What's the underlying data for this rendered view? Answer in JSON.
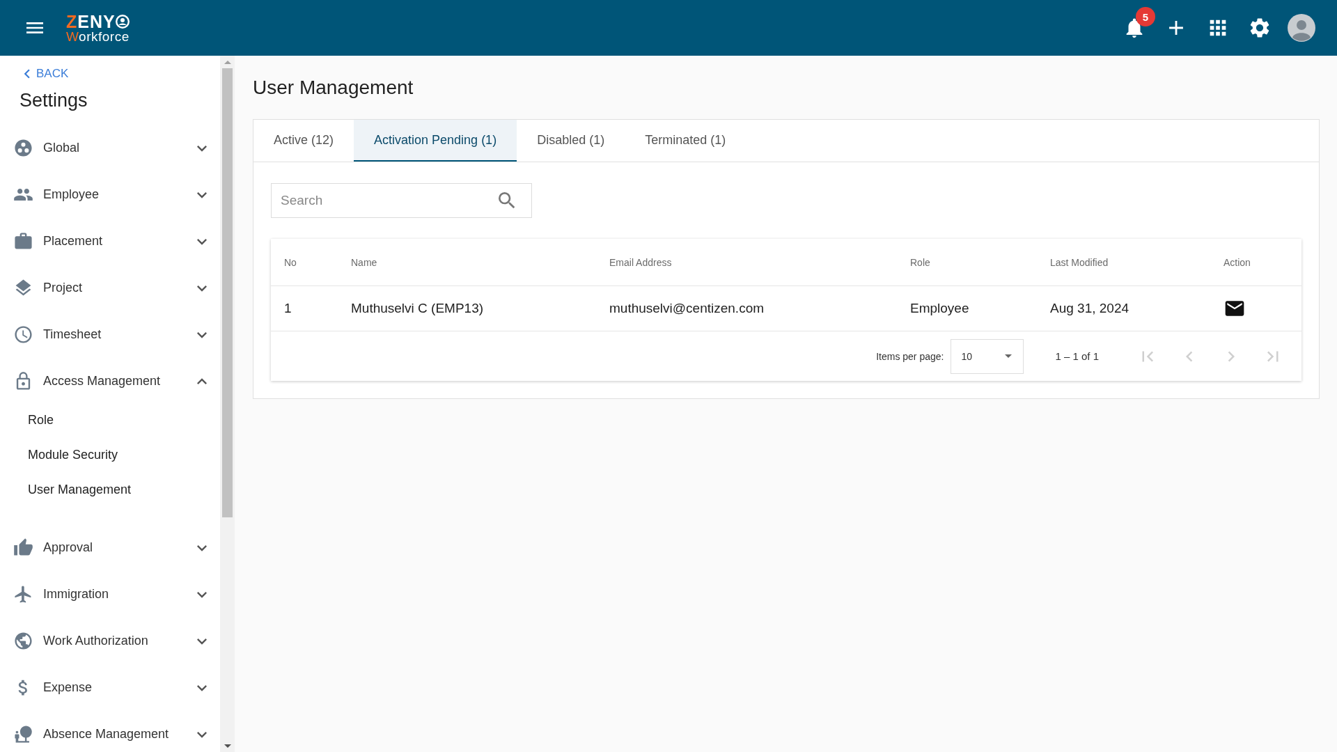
{
  "topbar": {
    "logo": {
      "line_1": {
        "accent": "Z",
        "rest": "ENY"
      },
      "line_2": {
        "accent": "W",
        "rest": "orkforce"
      }
    },
    "notification_count": "5"
  },
  "sidebar": {
    "back_label": "BACK",
    "title": "Settings",
    "items": [
      {
        "label": "Global",
        "expanded": false
      },
      {
        "label": "Employee",
        "expanded": false
      },
      {
        "label": "Placement",
        "expanded": false
      },
      {
        "label": "Project",
        "expanded": false
      },
      {
        "label": "Timesheet",
        "expanded": false
      },
      {
        "label": "Access Management",
        "expanded": true,
        "children": [
          {
            "label": "Role"
          },
          {
            "label": "Module Security"
          },
          {
            "label": "User Management"
          }
        ]
      },
      {
        "label": "Approval",
        "expanded": false
      },
      {
        "label": "Immigration",
        "expanded": false
      },
      {
        "label": "Work Authorization",
        "expanded": false
      },
      {
        "label": "Expense",
        "expanded": false
      },
      {
        "label": "Absence Management",
        "expanded": false
      }
    ]
  },
  "page": {
    "title": "User Management"
  },
  "tabs": [
    {
      "label": "Active (12)",
      "selected": false
    },
    {
      "label": "Activation Pending (1)",
      "selected": true
    },
    {
      "label": "Disabled (1)",
      "selected": false
    },
    {
      "label": "Terminated (1)",
      "selected": false
    }
  ],
  "search": {
    "placeholder": "Search"
  },
  "table": {
    "columns": [
      "No",
      "Name",
      "Email Address",
      "Role",
      "Last Modified",
      "Action"
    ],
    "rows": [
      {
        "cells": [
          "1",
          "Muthuselvi C (EMP13)",
          "muthuselvi@centizen.com",
          "Employee",
          "Aug 31, 2024"
        ]
      }
    ]
  },
  "pagination": {
    "label": "Items per page:",
    "page_size": "10",
    "range": "1 – 1 of 1",
    "buttons": [
      {
        "disabled": true
      },
      {
        "disabled": true
      },
      {
        "disabled": true
      },
      {
        "disabled": true
      }
    ]
  }
}
